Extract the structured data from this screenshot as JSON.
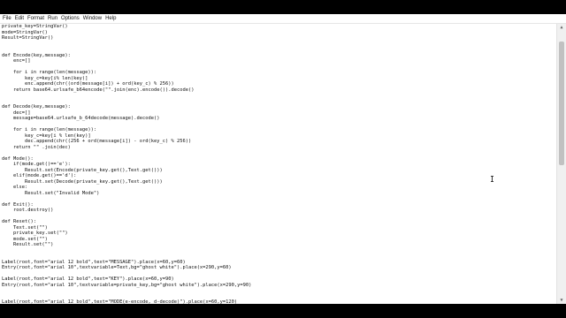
{
  "menu": [
    "File",
    "Edit",
    "Format",
    "Run",
    "Options",
    "Window",
    "Help"
  ],
  "code": [
    "private_key=StringVar()",
    "mode=StringVar()",
    "Result=StringVar()",
    "",
    "",
    "def Encode(key,message):",
    "    enc=[]",
    "",
    "    for i in range(len(message)):",
    "        key_c=key[i% len(key)]",
    "        enc.append(chr((ord(message[i]) + ord(key_c) % 256))",
    "    return base64.urlsafe_b64encode(\"\".join(enc).encode()).decode()",
    "",
    "",
    "def Decode(key,message):",
    "    dec=[]",
    "    message=base64.urlsafe_b_64decode(message).decode()",
    "",
    "    for i in range(len(message)):",
    "        key_c=key[i % len(key)]",
    "        dec.append(chr((256 + ord(message[i]) - ord(key_c) % 256))",
    "    return \"\" .join(dec)",
    "",
    "def Mode():",
    "    if(mode.get()=='e'):",
    "        Result.set(Encode(private_key.get(),Text.get()))",
    "    elif(mode.get()=='d'):",
    "        Result.set(Decode(private_key.get(),Text.get()))",
    "    else:",
    "        Result.set(\"Invalid Mode\")",
    "",
    "def Exit():",
    "    root.destroy()",
    "",
    "def Reset():",
    "    Text.set(\"\")",
    "    private_key.set(\"\")",
    "    mode.set(\"\")",
    "    Result.set(\"\")",
    "",
    "",
    "Label(root,font=\"arial 12 bold\",text=\"MESSAGE\").place(x=60,y=60)",
    "Entry(root,font=\"arial 10\",textvariable=Text,bg=\"ghost white\").place(x=290,y=60)",
    "",
    "Label(root,font=\"arial 12 bold\",text=\"KEY\").place(x=60,y=90)",
    "Entry(root,font=\"arial 10\",textvariable=private_key,bg=\"ghost white\").place(x=290,y=90)",
    "",
    "",
    "Label(root,font=\"arial 12 bold\",text=\"MODE(e-encode, d-decode)\").place(x=60,y=120)"
  ]
}
